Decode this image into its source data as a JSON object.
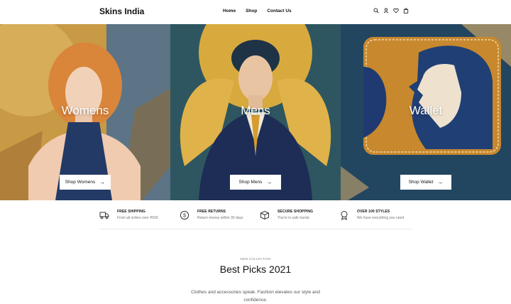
{
  "header": {
    "brand": "Skins India",
    "nav": [
      "Home",
      "Shop",
      "Contact Us"
    ],
    "icons": [
      "search-icon",
      "user-icon",
      "heart-icon",
      "bag-icon"
    ]
  },
  "hero": {
    "panels": [
      {
        "title": "Womens",
        "button": "Shop Womens"
      },
      {
        "title": "Mens",
        "button": "Shop Mens"
      },
      {
        "title": "Wallet",
        "button": "Shop Wallet"
      }
    ]
  },
  "features": [
    {
      "title": "FREE SHIPPING",
      "desc": "From all orders over ₹500",
      "icon": "truck-icon"
    },
    {
      "title": "FREE RETURNS",
      "desc": "Return money within 30 days",
      "icon": "money-return-icon"
    },
    {
      "title": "SECURE SHOPPING",
      "desc": "You're in safe hands",
      "icon": "box-icon"
    },
    {
      "title": "OVER 100 STYLES",
      "desc": "We have everything you need",
      "icon": "badge-icon"
    }
  ],
  "collection": {
    "kicker": "NEW COLLECTION",
    "title": "Best Picks 2021",
    "description": "Clothes and accessories speak. Fashion elevates our style and confidence."
  }
}
